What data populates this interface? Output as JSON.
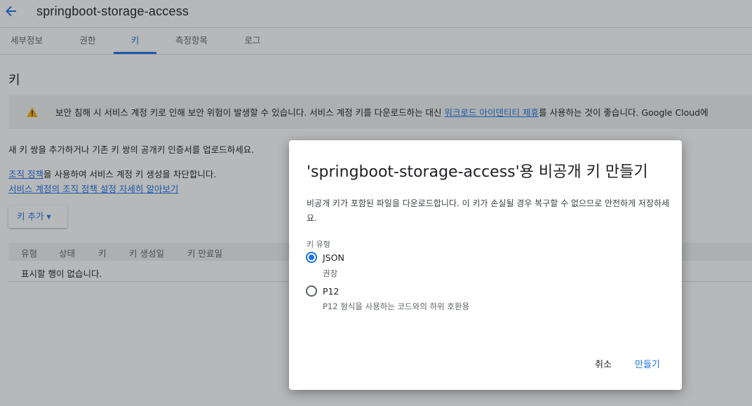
{
  "header": {
    "back_icon": "arrow-left-icon",
    "title": "springboot-storage-access"
  },
  "tabs": [
    {
      "label": "세부정보"
    },
    {
      "label": "권한"
    },
    {
      "label": "키",
      "active": true
    },
    {
      "label": "측정항목"
    },
    {
      "label": "로그"
    }
  ],
  "main": {
    "section_title": "키",
    "warning": {
      "icon": "warning-icon",
      "text_before": "보안 침해 시 서비스 계정 키로 인해 보안 위험이 발생할 수 있습니다. 서비스 계정 키를 다운로드하는 대신 ",
      "link_text": "워크로드 아이덴티티 제휴",
      "text_after": "를 사용하는 것이 좋습니다. Google Cloud에"
    },
    "add_key_text": "새 키 쌍을 추가하거나 기존 키 쌍의 공개키 인증서를 업로드하세요.",
    "org_policy_link": "조직 정책",
    "org_policy_text": "을 사용하여 서비스 계정 키 생성을 차단합니다.",
    "learn_more_link": "서비스 계정의 조직 정책 설정 자세히 알아보기",
    "add_key_button": "키 추가 ▾",
    "table": {
      "headers": [
        "유형",
        "상태",
        "키",
        "키 생성일",
        "키 만료일"
      ],
      "empty_text": "표시할 행이 없습니다."
    }
  },
  "dialog": {
    "title": "'springboot-storage-access'용 비공개 키 만들기",
    "description": "비공개 키가 포함된 파일을 다운로드합니다. 이 키가 손실될 경우 복구할 수 없으므로 안전하게 저장하세요.",
    "key_type_label": "키 유형",
    "options": [
      {
        "label": "JSON",
        "sublabel": "권장",
        "checked": true
      },
      {
        "label": "P12",
        "sublabel": "P12 형식을 사용하는 코드와의 하위 호환용",
        "checked": false
      }
    ],
    "cancel_label": "취소",
    "create_label": "만들기"
  },
  "colors": {
    "accent": "#1a73e8",
    "warning": "#f9ab00"
  }
}
